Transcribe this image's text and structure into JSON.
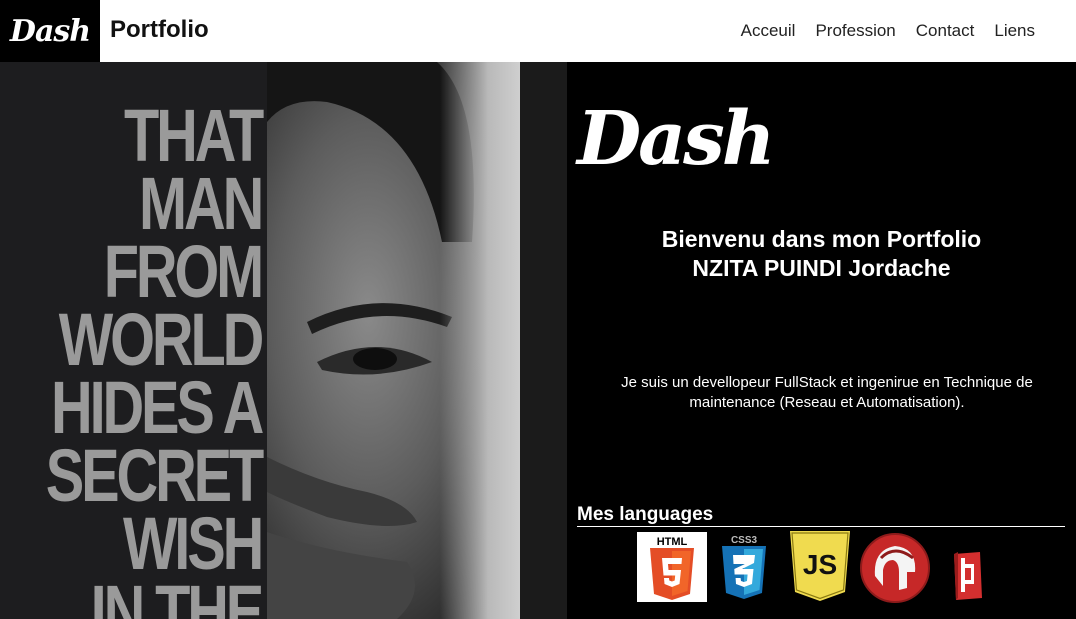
{
  "header": {
    "logo_text": "Dash",
    "brand": "Portfolio",
    "nav": [
      "Acceuil",
      "Profession",
      "Contact",
      "Liens"
    ]
  },
  "hero": {
    "quote_lines": [
      "THAT",
      "MAN",
      "FROM",
      "WORLD",
      "HIDES A",
      "SECRET",
      "WISH",
      "IN THE"
    ]
  },
  "panel": {
    "logo_text": "Dash",
    "welcome_line1": "Bienvenu dans mon Portfolio",
    "welcome_line2": "NZITA PUINDI Jordache",
    "description": "Je suis un devellopeur FullStack et ingenirue en Technique de maintenance (Reseau et Automatisation).",
    "languages_title": "Mes languages",
    "languages": [
      {
        "name": "html5-icon",
        "label": "HTML",
        "color": "#e44d26"
      },
      {
        "name": "css3-icon",
        "label": "CSS3",
        "color": "#1572b6"
      },
      {
        "name": "javascript-icon",
        "label": "JS",
        "color": "#f0db4f"
      },
      {
        "name": "spartan-helmet-icon",
        "color": "#c62828"
      },
      {
        "name": "red-book-icon",
        "color": "#d32f2f"
      }
    ]
  }
}
